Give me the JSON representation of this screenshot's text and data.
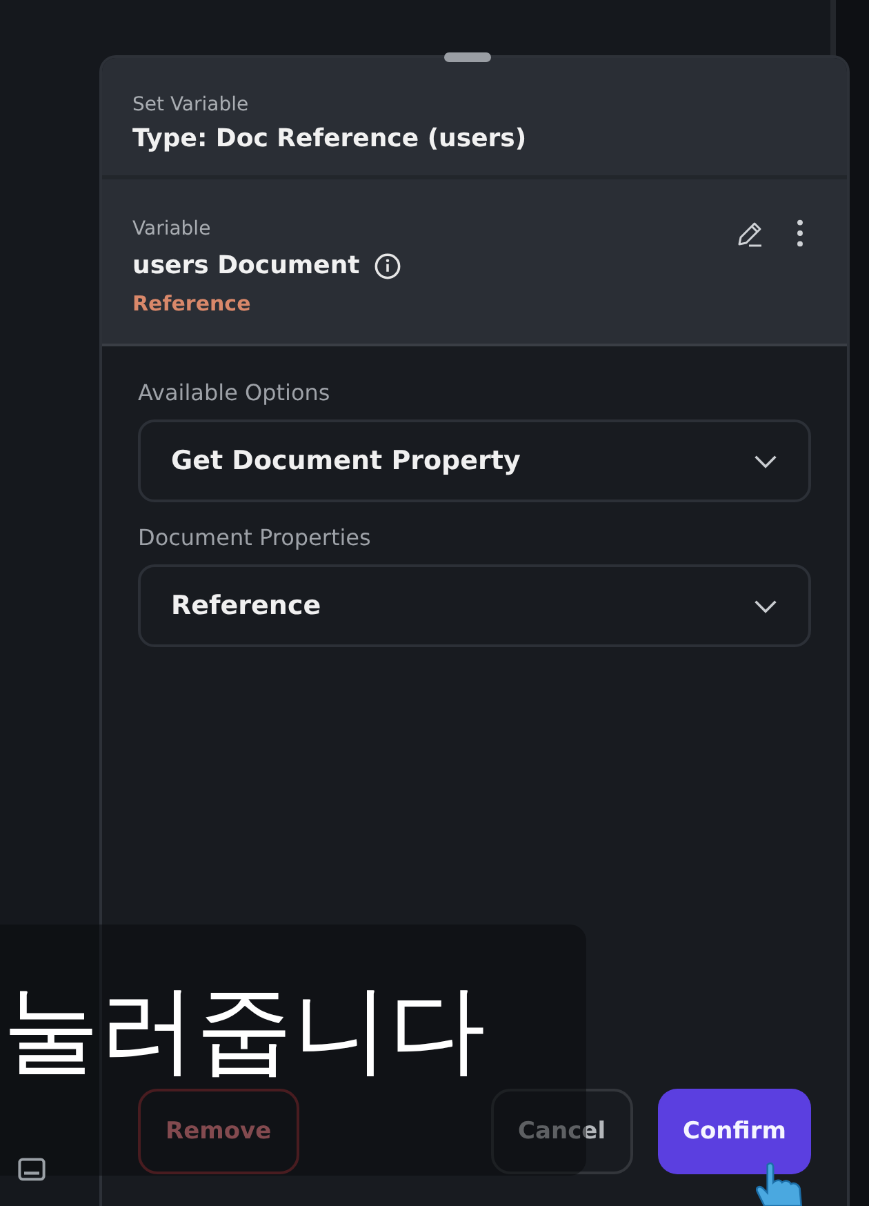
{
  "panel": {
    "title": "Set Variable",
    "type_line": "Type: Doc Reference (users)"
  },
  "variable": {
    "label": "Variable",
    "name": "users Document",
    "kind_label": "Reference"
  },
  "fields": [
    {
      "label": "Available Options",
      "value": "Get Document Property"
    },
    {
      "label": "Document Properties",
      "value": "Reference"
    }
  ],
  "buttons": [
    {
      "label": "Remove",
      "kind": "danger"
    },
    {
      "label": "Cancel",
      "kind": "plain"
    },
    {
      "label": "Confirm",
      "kind": "primary"
    }
  ],
  "subtitle": "눌러줍니다"
}
